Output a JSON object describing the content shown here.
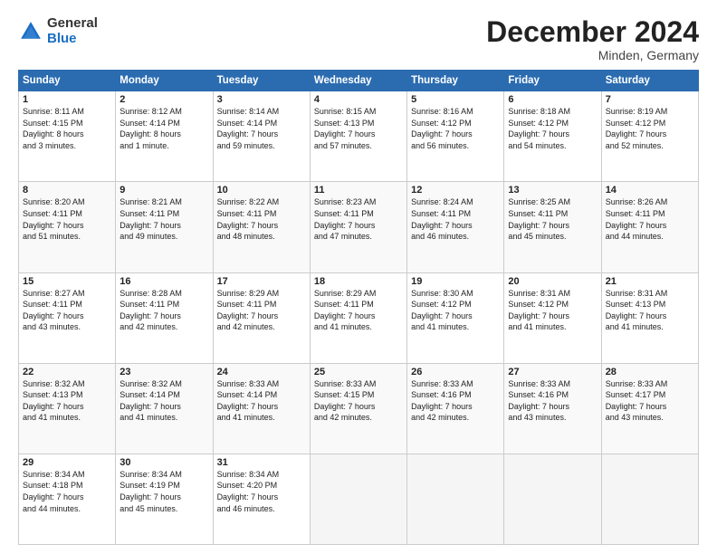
{
  "logo": {
    "general": "General",
    "blue": "Blue"
  },
  "header": {
    "month": "December 2024",
    "location": "Minden, Germany"
  },
  "weekdays": [
    "Sunday",
    "Monday",
    "Tuesday",
    "Wednesday",
    "Thursday",
    "Friday",
    "Saturday"
  ],
  "weeks": [
    [
      {
        "day": "1",
        "info": "Sunrise: 8:11 AM\nSunset: 4:15 PM\nDaylight: 8 hours\nand 3 minutes."
      },
      {
        "day": "2",
        "info": "Sunrise: 8:12 AM\nSunset: 4:14 PM\nDaylight: 8 hours\nand 1 minute."
      },
      {
        "day": "3",
        "info": "Sunrise: 8:14 AM\nSunset: 4:14 PM\nDaylight: 7 hours\nand 59 minutes."
      },
      {
        "day": "4",
        "info": "Sunrise: 8:15 AM\nSunset: 4:13 PM\nDaylight: 7 hours\nand 57 minutes."
      },
      {
        "day": "5",
        "info": "Sunrise: 8:16 AM\nSunset: 4:12 PM\nDaylight: 7 hours\nand 56 minutes."
      },
      {
        "day": "6",
        "info": "Sunrise: 8:18 AM\nSunset: 4:12 PM\nDaylight: 7 hours\nand 54 minutes."
      },
      {
        "day": "7",
        "info": "Sunrise: 8:19 AM\nSunset: 4:12 PM\nDaylight: 7 hours\nand 52 minutes."
      }
    ],
    [
      {
        "day": "8",
        "info": "Sunrise: 8:20 AM\nSunset: 4:11 PM\nDaylight: 7 hours\nand 51 minutes."
      },
      {
        "day": "9",
        "info": "Sunrise: 8:21 AM\nSunset: 4:11 PM\nDaylight: 7 hours\nand 49 minutes."
      },
      {
        "day": "10",
        "info": "Sunrise: 8:22 AM\nSunset: 4:11 PM\nDaylight: 7 hours\nand 48 minutes."
      },
      {
        "day": "11",
        "info": "Sunrise: 8:23 AM\nSunset: 4:11 PM\nDaylight: 7 hours\nand 47 minutes."
      },
      {
        "day": "12",
        "info": "Sunrise: 8:24 AM\nSunset: 4:11 PM\nDaylight: 7 hours\nand 46 minutes."
      },
      {
        "day": "13",
        "info": "Sunrise: 8:25 AM\nSunset: 4:11 PM\nDaylight: 7 hours\nand 45 minutes."
      },
      {
        "day": "14",
        "info": "Sunrise: 8:26 AM\nSunset: 4:11 PM\nDaylight: 7 hours\nand 44 minutes."
      }
    ],
    [
      {
        "day": "15",
        "info": "Sunrise: 8:27 AM\nSunset: 4:11 PM\nDaylight: 7 hours\nand 43 minutes."
      },
      {
        "day": "16",
        "info": "Sunrise: 8:28 AM\nSunset: 4:11 PM\nDaylight: 7 hours\nand 42 minutes."
      },
      {
        "day": "17",
        "info": "Sunrise: 8:29 AM\nSunset: 4:11 PM\nDaylight: 7 hours\nand 42 minutes."
      },
      {
        "day": "18",
        "info": "Sunrise: 8:29 AM\nSunset: 4:11 PM\nDaylight: 7 hours\nand 41 minutes."
      },
      {
        "day": "19",
        "info": "Sunrise: 8:30 AM\nSunset: 4:12 PM\nDaylight: 7 hours\nand 41 minutes."
      },
      {
        "day": "20",
        "info": "Sunrise: 8:31 AM\nSunset: 4:12 PM\nDaylight: 7 hours\nand 41 minutes."
      },
      {
        "day": "21",
        "info": "Sunrise: 8:31 AM\nSunset: 4:13 PM\nDaylight: 7 hours\nand 41 minutes."
      }
    ],
    [
      {
        "day": "22",
        "info": "Sunrise: 8:32 AM\nSunset: 4:13 PM\nDaylight: 7 hours\nand 41 minutes."
      },
      {
        "day": "23",
        "info": "Sunrise: 8:32 AM\nSunset: 4:14 PM\nDaylight: 7 hours\nand 41 minutes."
      },
      {
        "day": "24",
        "info": "Sunrise: 8:33 AM\nSunset: 4:14 PM\nDaylight: 7 hours\nand 41 minutes."
      },
      {
        "day": "25",
        "info": "Sunrise: 8:33 AM\nSunset: 4:15 PM\nDaylight: 7 hours\nand 42 minutes."
      },
      {
        "day": "26",
        "info": "Sunrise: 8:33 AM\nSunset: 4:16 PM\nDaylight: 7 hours\nand 42 minutes."
      },
      {
        "day": "27",
        "info": "Sunrise: 8:33 AM\nSunset: 4:16 PM\nDaylight: 7 hours\nand 43 minutes."
      },
      {
        "day": "28",
        "info": "Sunrise: 8:33 AM\nSunset: 4:17 PM\nDaylight: 7 hours\nand 43 minutes."
      }
    ],
    [
      {
        "day": "29",
        "info": "Sunrise: 8:34 AM\nSunset: 4:18 PM\nDaylight: 7 hours\nand 44 minutes."
      },
      {
        "day": "30",
        "info": "Sunrise: 8:34 AM\nSunset: 4:19 PM\nDaylight: 7 hours\nand 45 minutes."
      },
      {
        "day": "31",
        "info": "Sunrise: 8:34 AM\nSunset: 4:20 PM\nDaylight: 7 hours\nand 46 minutes."
      },
      {
        "day": "",
        "info": ""
      },
      {
        "day": "",
        "info": ""
      },
      {
        "day": "",
        "info": ""
      },
      {
        "day": "",
        "info": ""
      }
    ]
  ]
}
